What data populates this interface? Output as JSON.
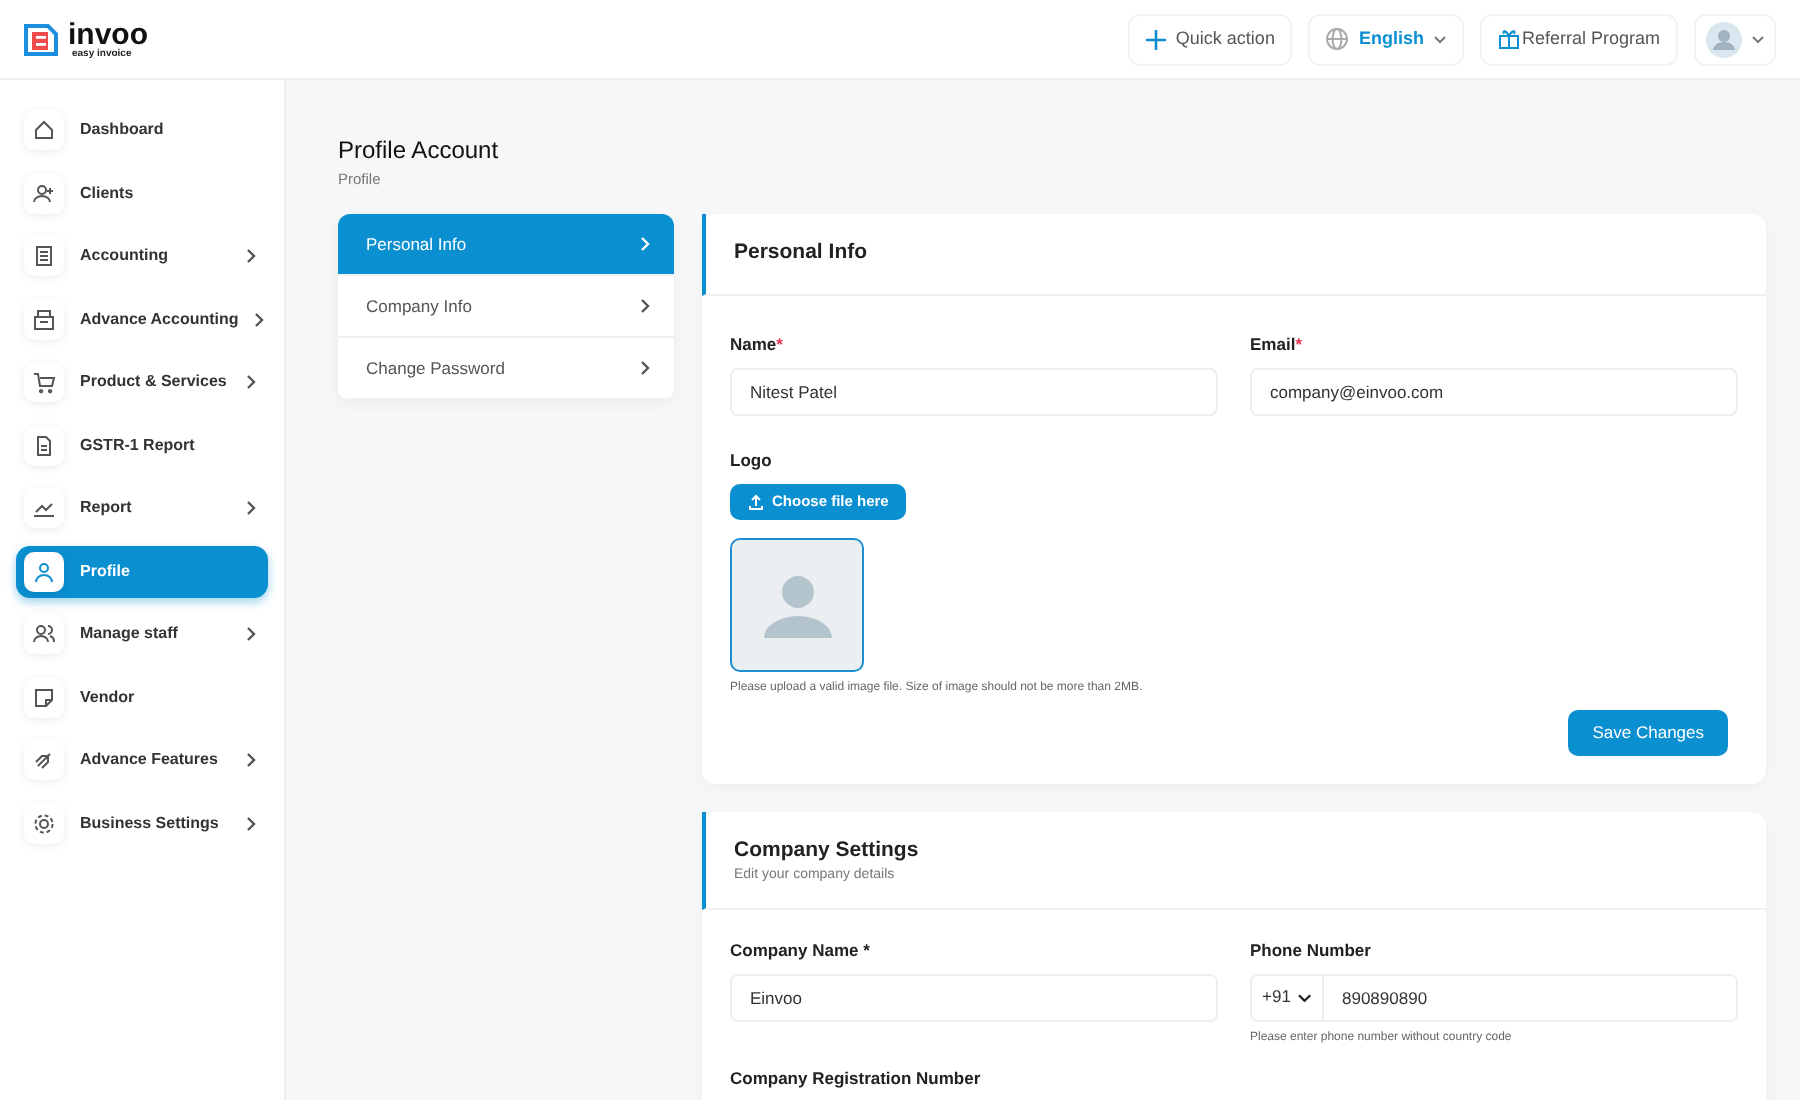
{
  "logo": {
    "name": "invoo",
    "tagline": "easy invoice"
  },
  "header": {
    "quick_action": "Quick action",
    "language": "English",
    "referral": "Referral Program"
  },
  "sidebar": {
    "items": [
      {
        "label": "Dashboard",
        "has_submenu": false,
        "selected": false
      },
      {
        "label": "Clients",
        "has_submenu": false,
        "selected": false
      },
      {
        "label": "Accounting",
        "has_submenu": true,
        "selected": false
      },
      {
        "label": "Advance Accounting",
        "has_submenu": true,
        "selected": false
      },
      {
        "label": "Product & Services",
        "has_submenu": true,
        "selected": false
      },
      {
        "label": "GSTR-1 Report",
        "has_submenu": false,
        "selected": false
      },
      {
        "label": "Report",
        "has_submenu": true,
        "selected": false
      },
      {
        "label": "Profile",
        "has_submenu": false,
        "selected": true
      },
      {
        "label": "Manage staff",
        "has_submenu": true,
        "selected": false
      },
      {
        "label": "Vendor",
        "has_submenu": false,
        "selected": false
      },
      {
        "label": "Advance Features",
        "has_submenu": true,
        "selected": false
      },
      {
        "label": "Business Settings",
        "has_submenu": true,
        "selected": false
      }
    ]
  },
  "page": {
    "title": "Profile Account",
    "breadcrumb": "Profile"
  },
  "profile_menu": [
    {
      "label": "Personal Info",
      "selected": true
    },
    {
      "label": "Company Info",
      "selected": false
    },
    {
      "label": "Change Password",
      "selected": false
    }
  ],
  "personal_info": {
    "title": "Personal Info",
    "fields": [
      {
        "label": "Name",
        "required_mark": "*",
        "value": "Nitest Patel"
      },
      {
        "label": "Email",
        "required_mark": "*",
        "value": "company@einvoo.com"
      }
    ],
    "logo": {
      "label": "Logo",
      "button": "Choose file here",
      "hint": "Please upload a valid image file. Size of image should not be more than 2MB."
    },
    "save_button": "Save Changes"
  },
  "company_settings": {
    "title": "Company Settings",
    "subtitle": "Edit your company details",
    "fields": [
      {
        "kind": "text",
        "label": "Company Name *",
        "value": "Einvoo"
      },
      {
        "kind": "phone",
        "label": "Phone Number",
        "country_code": "+91",
        "value": "890890890",
        "hint": "Please enter phone number without country code"
      }
    ],
    "next_label": "Company Registration Number"
  }
}
